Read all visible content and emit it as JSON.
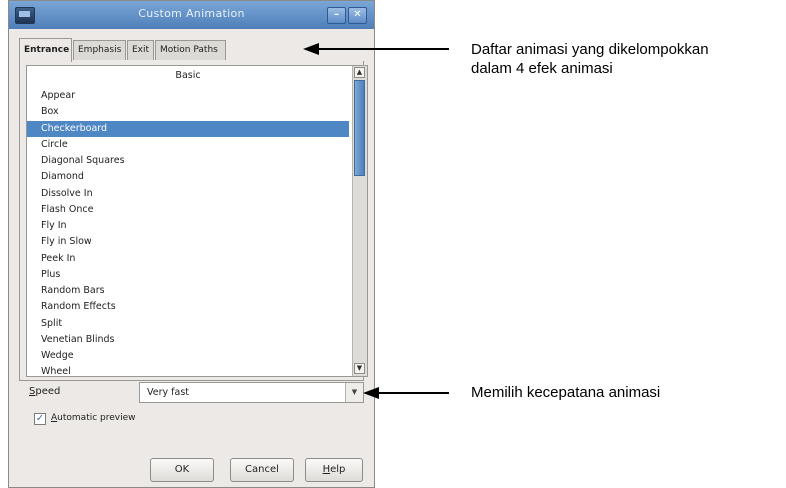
{
  "window": {
    "title": "Custom Animation"
  },
  "tabs": [
    {
      "label": "Entrance"
    },
    {
      "label": "Emphasis"
    },
    {
      "label": "Exit"
    },
    {
      "label": "Motion Paths"
    }
  ],
  "list": {
    "header": "Basic",
    "items": [
      "Appear",
      "Box",
      "Checkerboard",
      "Circle",
      "Diagonal Squares",
      "Diamond",
      "Dissolve In",
      "Flash Once",
      "Fly In",
      "Fly in Slow",
      "Peek In",
      "Plus",
      "Random Bars",
      "Random Effects",
      "Split",
      "Venetian Blinds",
      "Wedge",
      "Wheel"
    ],
    "selected_index": 2
  },
  "speed": {
    "label_accel": "S",
    "label_rest": "peed",
    "value": "Very fast"
  },
  "preview": {
    "checked": true,
    "label_accel": "A",
    "label_rest": "utomatic preview"
  },
  "buttons": {
    "ok": "OK",
    "cancel": "Cancel",
    "help_accel": "H",
    "help_rest": "elp"
  },
  "annotations": {
    "tabs_note": "Daftar animasi yang dikelompokkan dalam 4 efek animasi",
    "tabs_note_line1": "Daftar animasi yang dikelompokkan",
    "tabs_note_line2": "dalam 4 efek animasi",
    "speed_note": "Memilih kecepatana animasi"
  },
  "colors": {
    "titlebar": "#5f8ec6",
    "selection": "#4f86c4",
    "dialog_bg": "#ece9e6"
  }
}
